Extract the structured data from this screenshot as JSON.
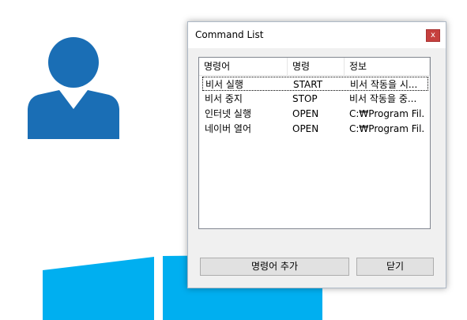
{
  "dialog": {
    "title": "Command List",
    "close_label": "x"
  },
  "list": {
    "columns": [
      "명령어",
      "명령",
      "정보"
    ],
    "rows": [
      {
        "keyword": "비서 실행",
        "command": "START",
        "info": "비서 작동을 시..."
      },
      {
        "keyword": "비서 중지",
        "command": "STOP",
        "info": "비서 작동을 중..."
      },
      {
        "keyword": "인터넷 실행",
        "command": "OPEN",
        "info": "C:₩Program Fil..."
      },
      {
        "keyword": "네이버 열어",
        "command": "OPEN",
        "info": "C:₩Program Fil..."
      }
    ]
  },
  "buttons": {
    "add_label": "명령어 추가",
    "close_label": "닫기"
  },
  "colors": {
    "person_icon": "#1a6eb5",
    "windows_logo": "#00aff0",
    "close_button": "#c6403e"
  },
  "icons": {
    "background_person": "person-icon",
    "background_windows": "windows-logo-icon"
  }
}
